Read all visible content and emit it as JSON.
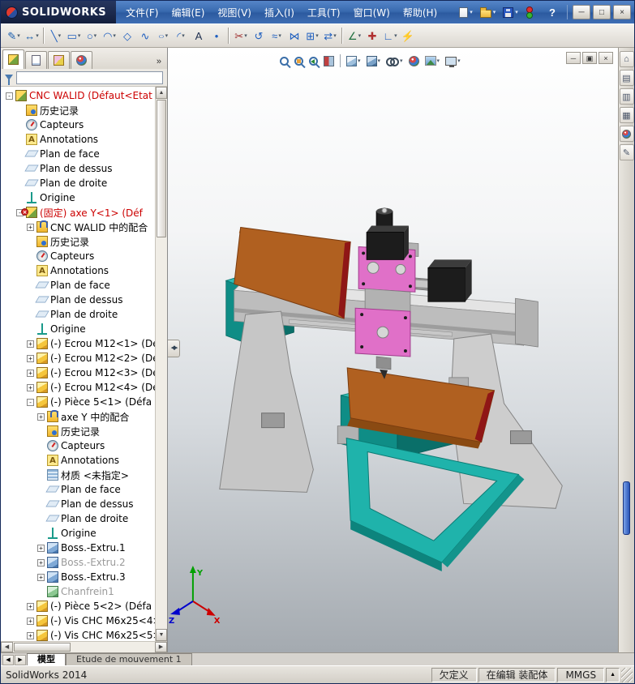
{
  "titlebar": {
    "brand": "SOLIDWORKS",
    "menus": [
      "文件(F)",
      "编辑(E)",
      "视图(V)",
      "插入(I)",
      "工具(T)",
      "窗口(W)",
      "帮助(H)"
    ],
    "quick_access": [
      {
        "name": "new-document-button",
        "icon": "new",
        "caret": true
      },
      {
        "name": "open-document-button",
        "icon": "open",
        "caret": true
      },
      {
        "name": "save-button",
        "icon": "save",
        "caret": true
      },
      {
        "name": "performance-indicator",
        "icon": "perf",
        "caret": false
      }
    ],
    "help_label": "?",
    "window_buttons": {
      "minimize": "─",
      "maximize": "□",
      "close": "×"
    }
  },
  "ui": {
    "caret": "▾",
    "up": "▲",
    "down": "▼",
    "left": "◀",
    "right": "▶",
    "splitter": "◀▶",
    "units_caret": "▲",
    "badge": "×",
    "chevron": "»"
  },
  "toolbar": {
    "buttons": [
      {
        "name": "sketch",
        "glyph": "✎",
        "color": "#1a5fb0",
        "caret": true
      },
      {
        "name": "smart-dimension",
        "glyph": "↔",
        "color": "#1a5fb0",
        "caret": true
      },
      {
        "sep": true
      },
      {
        "name": "line",
        "glyph": "╲",
        "color": "#2060c0",
        "caret": true
      },
      {
        "name": "rectangle",
        "glyph": "▭",
        "color": "#2060c0",
        "caret": true
      },
      {
        "name": "circle",
        "glyph": "○",
        "color": "#2060c0",
        "caret": true
      },
      {
        "name": "arc",
        "glyph": "◠",
        "color": "#2060c0",
        "caret": true
      },
      {
        "name": "polygon",
        "glyph": "◇",
        "color": "#2060c0",
        "caret": false
      },
      {
        "name": "spline",
        "glyph": "∿",
        "color": "#2060c0",
        "caret": false
      },
      {
        "name": "ellipse",
        "glyph": "○",
        "color": "#2060c0",
        "caret": true,
        "squish": true
      },
      {
        "name": "sketch-fillet",
        "glyph": "◜",
        "color": "#2060c0",
        "caret": true
      },
      {
        "name": "text",
        "glyph": "A",
        "color": "#203050",
        "caret": false
      },
      {
        "name": "point",
        "glyph": "•",
        "color": "#2060c0",
        "caret": false
      },
      {
        "sep": true
      },
      {
        "name": "trim-entities",
        "glyph": "✂",
        "color": "#a03030",
        "caret": true
      },
      {
        "name": "convert-entities",
        "glyph": "↺",
        "color": "#2060c0",
        "caret": false
      },
      {
        "name": "offset-entities",
        "glyph": "≈",
        "color": "#2060c0",
        "caret": true
      },
      {
        "name": "mirror-entities",
        "glyph": "⋈",
        "color": "#2060c0",
        "caret": false
      },
      {
        "name": "linear-sketch-pattern",
        "glyph": "⊞",
        "color": "#2060c0",
        "caret": true
      },
      {
        "name": "move-entities",
        "glyph": "⇄",
        "color": "#2060c0",
        "caret": true
      },
      {
        "sep": true
      },
      {
        "name": "display-delete-relations",
        "glyph": "∠",
        "color": "#207040",
        "caret": true
      },
      {
        "name": "repair-sketch",
        "glyph": "✚",
        "color": "#b03030",
        "caret": false
      },
      {
        "name": "quick-snaps",
        "glyph": "∟",
        "color": "#2060c0",
        "caret": true
      },
      {
        "name": "rapid-sketch",
        "glyph": "⚡",
        "color": "#c08a10",
        "caret": false
      }
    ]
  },
  "left_panel": {
    "tabs": [
      {
        "name": "featuremanager-tab",
        "kind": "tree",
        "active": true
      },
      {
        "name": "propertymanager-tab",
        "kind": "page",
        "active": false
      },
      {
        "name": "configurationmanager-tab",
        "kind": "config",
        "active": false
      },
      {
        "name": "displaymanager-tab",
        "kind": "ball",
        "active": false
      }
    ],
    "chevron": "»"
  },
  "tree": {
    "items": [
      {
        "level": 0,
        "expand": "-",
        "icon": "asm",
        "label": "CNC WALID (Défaut<Etat",
        "color": "red"
      },
      {
        "level": 1,
        "expand": "",
        "icon": "hist",
        "label": "历史记录"
      },
      {
        "level": 1,
        "expand": "",
        "icon": "capt",
        "label": "Capteurs"
      },
      {
        "level": 1,
        "expand": "",
        "icon": "annot",
        "label": "Annotations"
      },
      {
        "level": 1,
        "expand": "",
        "icon": "plane",
        "label": "Plan de face"
      },
      {
        "level": 1,
        "expand": "",
        "icon": "plane",
        "label": "Plan de dessus"
      },
      {
        "level": 1,
        "expand": "",
        "icon": "plane",
        "label": "Plan de droite"
      },
      {
        "level": 1,
        "expand": "",
        "icon": "origin",
        "label": "Origine"
      },
      {
        "level": 1,
        "expand": "-",
        "icon": "asm",
        "label": "(固定) axe Y<1> (Déf",
        "color": "red",
        "badge": true
      },
      {
        "level": 2,
        "expand": "+",
        "icon": "mates",
        "label": "CNC WALID 中的配合"
      },
      {
        "level": 2,
        "expand": "",
        "icon": "hist",
        "label": "历史记录"
      },
      {
        "level": 2,
        "expand": "",
        "icon": "capt",
        "label": "Capteurs"
      },
      {
        "level": 2,
        "expand": "",
        "icon": "annot",
        "label": "Annotations"
      },
      {
        "level": 2,
        "expand": "",
        "icon": "plane",
        "label": "Plan de face"
      },
      {
        "level": 2,
        "expand": "",
        "icon": "plane",
        "label": "Plan de dessus"
      },
      {
        "level": 2,
        "expand": "",
        "icon": "plane",
        "label": "Plan de droite"
      },
      {
        "level": 2,
        "expand": "",
        "icon": "origin",
        "label": "Origine"
      },
      {
        "level": 2,
        "expand": "+",
        "icon": "part",
        "label": "(-) Ecrou M12<1> (Dé"
      },
      {
        "level": 2,
        "expand": "+",
        "icon": "part",
        "label": "(-) Ecrou M12<2> (Dé"
      },
      {
        "level": 2,
        "expand": "+",
        "icon": "part",
        "label": "(-) Ecrou M12<3> (Dé"
      },
      {
        "level": 2,
        "expand": "+",
        "icon": "part",
        "label": "(-) Ecrou M12<4> (Dé"
      },
      {
        "level": 2,
        "expand": "-",
        "icon": "part",
        "label": "(-) Pièce 5<1> (Défa"
      },
      {
        "level": 3,
        "expand": "+",
        "icon": "mates",
        "label": "axe Y 中的配合"
      },
      {
        "level": 3,
        "expand": "",
        "icon": "hist",
        "label": "历史记录"
      },
      {
        "level": 3,
        "expand": "",
        "icon": "capt",
        "label": "Capteurs"
      },
      {
        "level": 3,
        "expand": "",
        "icon": "annot",
        "label": "Annotations"
      },
      {
        "level": 3,
        "expand": "",
        "icon": "material",
        "label": "材质 <未指定>"
      },
      {
        "level": 3,
        "expand": "",
        "icon": "plane",
        "label": "Plan de face"
      },
      {
        "level": 3,
        "expand": "",
        "icon": "plane",
        "label": "Plan de dessus"
      },
      {
        "level": 3,
        "expand": "",
        "icon": "plane",
        "label": "Plan de droite"
      },
      {
        "level": 3,
        "expand": "",
        "icon": "origin",
        "label": "Origine"
      },
      {
        "level": 3,
        "expand": "+",
        "icon": "extrude",
        "label": "Boss.-Extru.1"
      },
      {
        "level": 3,
        "expand": "+",
        "icon": "extrude",
        "label": "Boss.-Extru.2",
        "color": "gray"
      },
      {
        "level": 3,
        "expand": "+",
        "icon": "extrude",
        "label": "Boss.-Extru.3"
      },
      {
        "level": 3,
        "expand": "",
        "icon": "chamfer",
        "label": "Chanfrein1",
        "color": "gray"
      },
      {
        "level": 2,
        "expand": "+",
        "icon": "part",
        "label": "(-) Pièce 5<2> (Défa"
      },
      {
        "level": 2,
        "expand": "+",
        "icon": "part",
        "label": "(-) Vis CHC M6x25<4>"
      },
      {
        "level": 2,
        "expand": "+",
        "icon": "part",
        "label": "(-) Vis CHC M6x25<5>"
      }
    ]
  },
  "viewport": {
    "hud": [
      {
        "name": "zoom-fit-button",
        "kind": "mag"
      },
      {
        "name": "zoom-area-button",
        "kind": "magarea"
      },
      {
        "name": "previous-view-button",
        "kind": "magprev"
      },
      {
        "name": "section-view-button",
        "kind": "section"
      },
      {
        "sep": true
      },
      {
        "name": "view-orientation-button",
        "kind": "cube",
        "caret": true
      },
      {
        "name": "display-style-button",
        "kind": "cube2",
        "caret": true
      },
      {
        "name": "hide-show-items-button",
        "kind": "glasses",
        "caret": true
      },
      {
        "name": "edit-appearance-button",
        "kind": "ball"
      },
      {
        "name": "apply-scene-button",
        "kind": "scene",
        "caret": true
      },
      {
        "name": "view-settings-button",
        "kind": "monitor",
        "caret": true
      }
    ],
    "doc_buttons": [
      {
        "name": "document-minimize-button",
        "glyph": "─"
      },
      {
        "name": "document-restore-button",
        "glyph": "▣"
      },
      {
        "name": "document-close-button",
        "glyph": "×"
      }
    ],
    "triad": {
      "x": "X",
      "y": "Y",
      "z": "Z"
    }
  },
  "task_pane": {
    "tabs": [
      {
        "name": "solidworks-resources-tab",
        "glyph": "⌂"
      },
      {
        "name": "design-library-tab",
        "glyph": "▤"
      },
      {
        "name": "file-explorer-tab",
        "glyph": "▥"
      },
      {
        "name": "view-palette-tab",
        "glyph": "▦"
      },
      {
        "name": "appearances-scenes-tab",
        "kind": "ball"
      },
      {
        "name": "custom-properties-tab",
        "glyph": "✎"
      }
    ]
  },
  "bottom_tabs": {
    "model": "模型",
    "motion": "Etude de mouvement 1"
  },
  "status_bar": {
    "app": "SolidWorks 2014",
    "state": "欠定义",
    "editing": "在编辑 装配体",
    "units": "MMGS"
  },
  "colors": {
    "teal": "#2fbcb4",
    "teal_dark": "#0f8d86",
    "teal_darker": "#0a6f69",
    "teal_frame": "#1fb3ab",
    "brown": "#b06020",
    "brown_dark": "#8a4a12",
    "red_edge": "#8f1616",
    "pink": "#e070c8",
    "axis_x": "#cc0000",
    "axis_y": "#00a000",
    "axis_z": "#0000cc",
    "tree_red": "#cc0000",
    "tree_gray": "#999999"
  }
}
